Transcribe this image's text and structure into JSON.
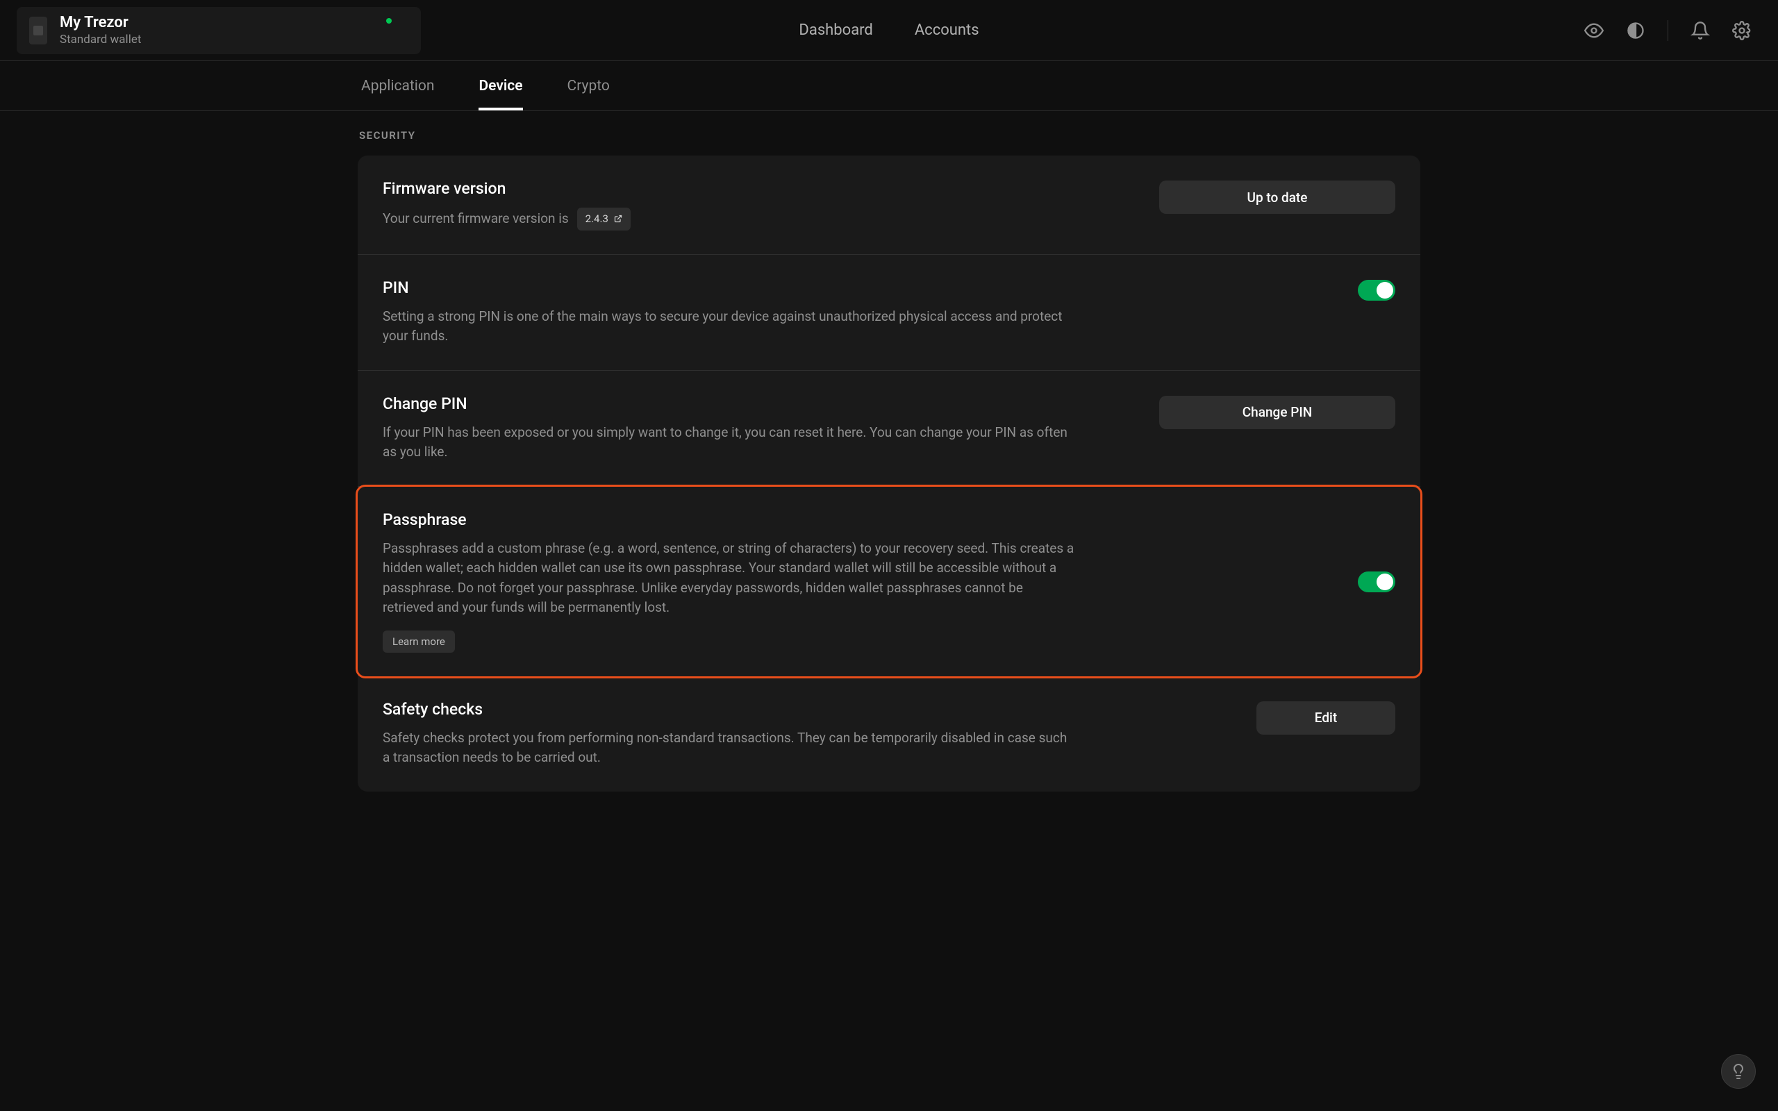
{
  "header": {
    "device_name": "My Trezor",
    "device_subtitle": "Standard wallet",
    "nav": {
      "dashboard": "Dashboard",
      "accounts": "Accounts"
    }
  },
  "subtabs": {
    "application": "Application",
    "device": "Device",
    "crypto": "Crypto",
    "active": "device"
  },
  "section_label": "SECURITY",
  "settings": {
    "firmware": {
      "title": "Firmware version",
      "desc": "Your current firmware version is",
      "version": "2.4.3",
      "button": "Up to date"
    },
    "pin": {
      "title": "PIN",
      "desc": "Setting a strong PIN is one of the main ways to secure your device against unauthorized physical access and protect your funds.",
      "toggle": true
    },
    "change_pin": {
      "title": "Change PIN",
      "desc": "If your PIN has been exposed or you simply want to change it, you can reset it here. You can change your PIN as often as you like.",
      "button": "Change PIN"
    },
    "passphrase": {
      "title": "Passphrase",
      "desc": "Passphrases add a custom phrase (e.g. a word, sentence, or string of characters) to your recovery seed. This creates a hidden wallet; each hidden wallet can use its own passphrase. Your standard wallet will still be accessible without a passphrase. Do not forget your passphrase. Unlike everyday passwords, hidden wallet passphrases cannot be retrieved and your funds will be permanently lost.",
      "learn_more": "Learn more",
      "toggle": true
    },
    "safety": {
      "title": "Safety checks",
      "desc": "Safety checks protect you from performing non-standard transactions. They can be temporarily disabled in case such a transaction needs to be carried out.",
      "button": "Edit"
    }
  },
  "colors": {
    "highlight_border": "#e94e1b",
    "toggle_on": "#00a854",
    "status_dot": "#00c853"
  }
}
